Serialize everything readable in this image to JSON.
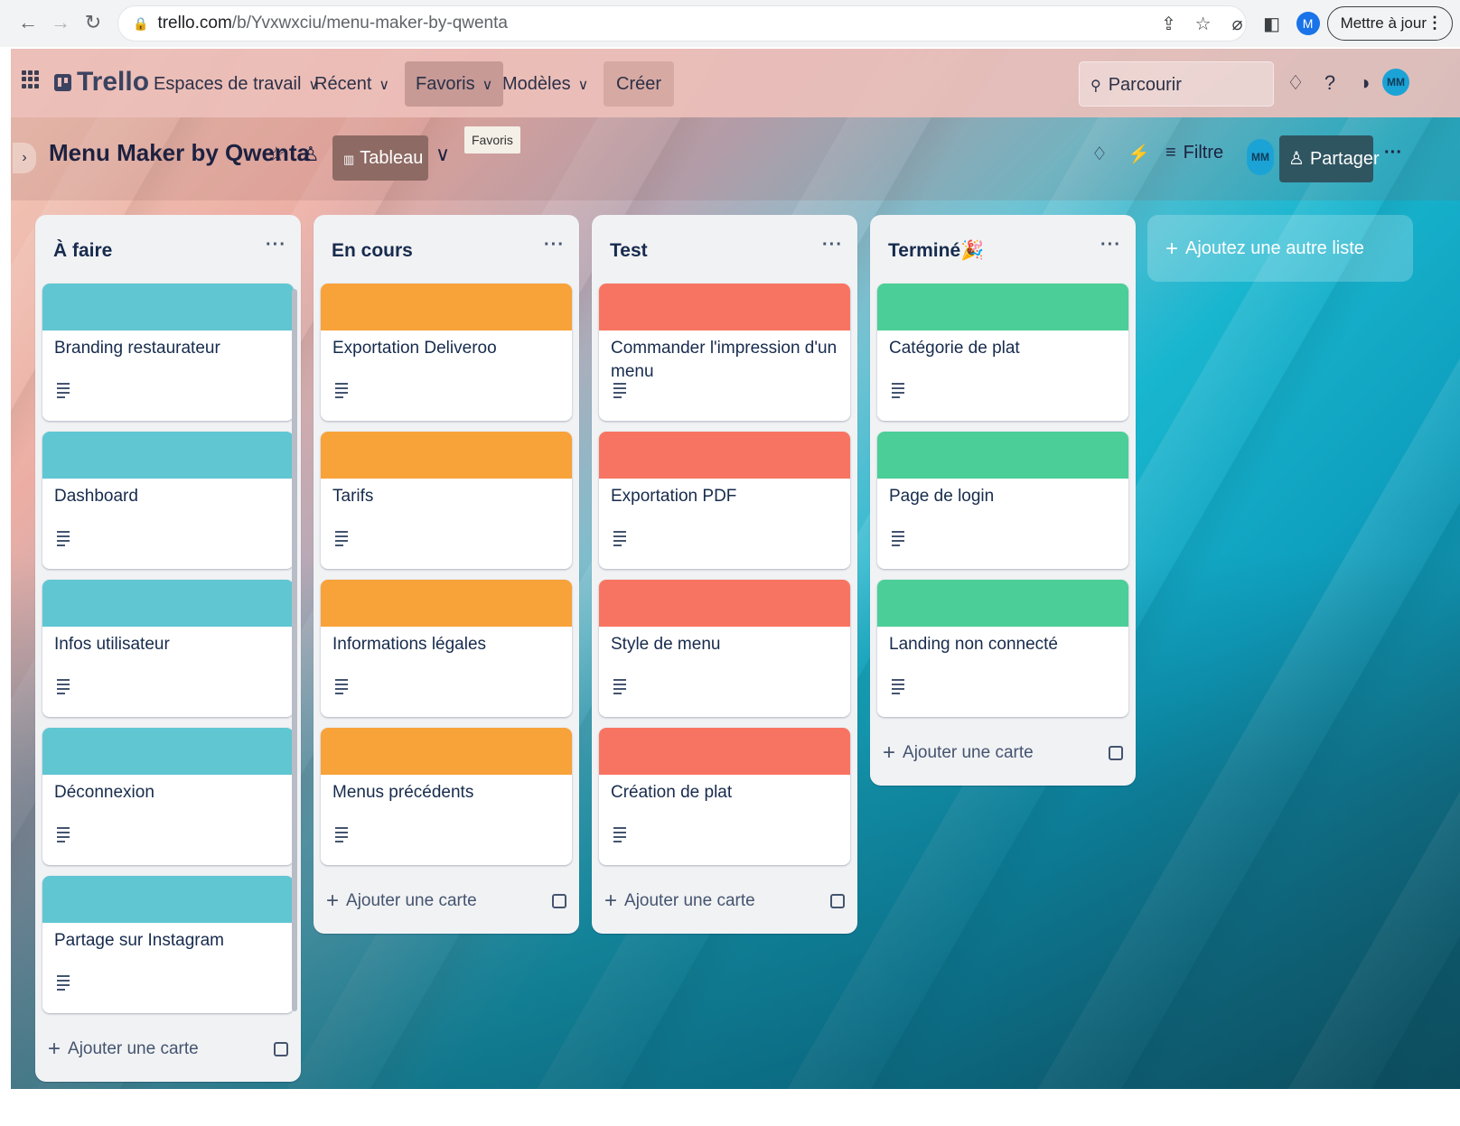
{
  "browser": {
    "url_host": "trello.com",
    "url_path": "/b/Yvxwxciu/menu-maker-by-qwenta",
    "profile_initial": "M",
    "update_button": "Mettre à jour",
    "icons": [
      "back-icon",
      "forward-icon",
      "reload-icon",
      "lock-icon",
      "share-icon",
      "bookmark-star-icon",
      "extension-icon",
      "sidepanel-icon",
      "profile-icon",
      "menu-icon"
    ]
  },
  "topnav": {
    "logo": "Trello",
    "workspaces": "Espaces de travail",
    "recent": "Récent",
    "favorites": "Favoris",
    "templates": "Modèles",
    "create": "Créer",
    "search_placeholder": "Parcourir",
    "avatar": "MM"
  },
  "boardbar": {
    "title": "Menu Maker by Qwenta",
    "view": "Tableau",
    "tooltip": "Favoris",
    "filter": "Filtre",
    "member_avatar": "MM",
    "share": "Partager"
  },
  "colors": {
    "teal": "#60c6d2",
    "orange": "#f8a23a",
    "red": "#f87462",
    "green": "#4bce97"
  },
  "lists": [
    {
      "title": "À faire",
      "cover": "#60c6d2",
      "cards": [
        "Branding restaurateur",
        "Dashboard",
        "Infos utilisateur",
        "Déconnexion",
        "Partage sur Instagram"
      ],
      "add_label": "Ajouter une carte"
    },
    {
      "title": "En cours",
      "cover": "#f8a23a",
      "cards": [
        "Exportation Deliveroo",
        "Tarifs",
        "Informations légales",
        "Menus précédents"
      ],
      "add_label": "Ajouter une carte"
    },
    {
      "title": "Test",
      "cover": "#f87462",
      "cards": [
        "Commander l'impression d'un menu",
        "Exportation PDF",
        "Style de menu",
        "Création de plat"
      ],
      "add_label": "Ajouter une carte"
    },
    {
      "title": "Terminé🎉",
      "cover": "#4bce97",
      "cards": [
        "Catégorie de plat",
        "Page de login",
        "Landing non connecté"
      ],
      "add_label": "Ajouter une carte"
    }
  ],
  "add_list_label": "Ajoutez une autre liste"
}
